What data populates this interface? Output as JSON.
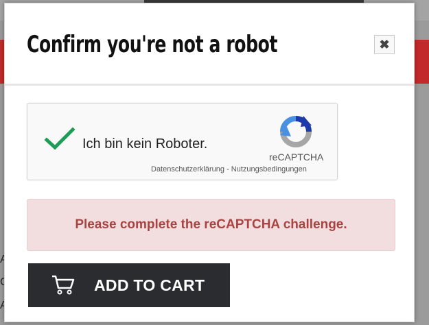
{
  "background": {
    "left_letters": [
      "A",
      "C",
      "A"
    ]
  },
  "modal": {
    "title": "Confirm you're not a robot",
    "close_symbol": "✖"
  },
  "recaptcha": {
    "label": "Ich bin kein Roboter.",
    "brand": "reCAPTCHA",
    "privacy_link": "Datenschutzerklärung",
    "separator": " - ",
    "terms_link": "Nutzungsbedingungen",
    "checked": true,
    "icons": {
      "check": "check-icon",
      "logo": "recaptcha-logo-icon"
    }
  },
  "alert": {
    "message": "Please complete the reCAPTCHA challenge."
  },
  "cart": {
    "button_label": "ADD TO CART",
    "icon": "cart-icon"
  },
  "colors": {
    "alert_text": "#a94442",
    "alert_bg": "#f2dede",
    "button_bg": "#2a2c30",
    "check_green": "#1e9b57",
    "brand_red": "#c22a2a"
  }
}
